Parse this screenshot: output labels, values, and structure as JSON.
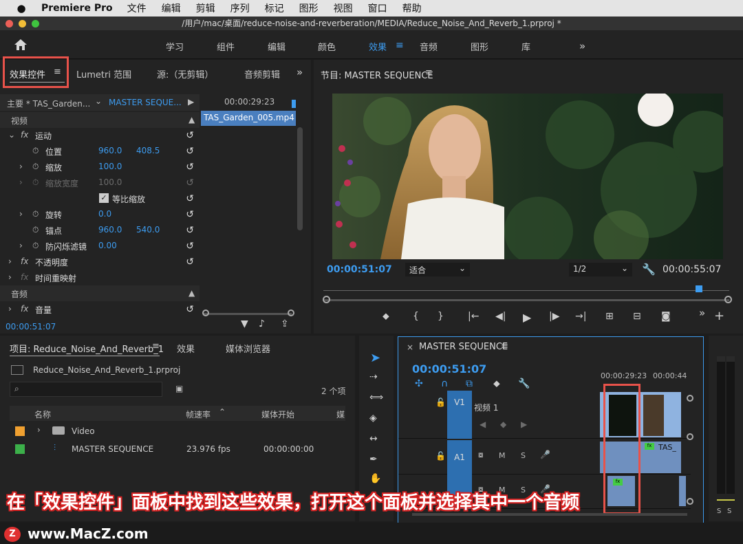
{
  "menubar": {
    "apple": "",
    "app": "Premiere Pro",
    "items": [
      "文件",
      "编辑",
      "剪辑",
      "序列",
      "标记",
      "图形",
      "视图",
      "窗口",
      "帮助"
    ]
  },
  "titlebar": {
    "path": "/用户/mac/桌面/reduce-noise-and-reverberation/MEDIA/Reduce_Noise_And_Reverb_1.prproj *"
  },
  "workspaces": {
    "items": [
      "学习",
      "组件",
      "编辑",
      "颜色",
      "效果",
      "音频",
      "图形",
      "库"
    ],
    "active": "效果",
    "more": "»"
  },
  "effect_controls": {
    "tabs": {
      "effect": "效果控件",
      "lumetri": "Lumetri 范围",
      "source": "源:（无剪辑）",
      "audio_clip": "音频剪辑",
      "more": "»"
    },
    "master_clip": "主要 * TAS_Garden...",
    "sequence_clip": "MASTER SEQUE...",
    "timecode_top": "00:00:29:23",
    "clip_name": "TAS_Garden_005.mp4",
    "video_header": "视频",
    "motion": "运动",
    "position": {
      "label": "位置",
      "x": "960.0",
      "y": "408.5"
    },
    "scale": {
      "label": "缩放",
      "value": "100.0"
    },
    "scale_width": {
      "label": "缩放宽度",
      "value": "100.0"
    },
    "uniform": {
      "label": "等比缩放"
    },
    "rotation": {
      "label": "旋转",
      "value": "0.0"
    },
    "anchor": {
      "label": "锚点",
      "x": "960.0",
      "y": "540.0"
    },
    "flicker": {
      "label": "防闪烁滤镜",
      "value": "0.00"
    },
    "opacity": "不透明度",
    "time_remap": "时间重映射",
    "audio_header": "音频",
    "volume": "音量",
    "timecode_bottom": "00:00:51:07"
  },
  "program": {
    "title": "节目: MASTER SEQUENCE",
    "timecode": "00:00:51:07",
    "fit": "适合",
    "resolution": "1/2",
    "duration": "00:00:55:07"
  },
  "project": {
    "tab": "项目: Reduce_Noise_And_Reverb_1",
    "effects_tab": "效果",
    "media_tab": "媒体浏览器",
    "file": "Reduce_Noise_And_Reverb_1.prproj",
    "count": "2 个项",
    "columns": {
      "name": "名称",
      "fps": "帧速率",
      "start": "媒体开始",
      "more": "媒"
    },
    "rows": [
      {
        "name": "Video",
        "fps": "",
        "start": "",
        "color": "#f0a030"
      },
      {
        "name": "MASTER SEQUENCE",
        "fps": "23.976 fps",
        "start": "00:00:00:00",
        "color": "#3cb04a"
      }
    ]
  },
  "timeline": {
    "title": "MASTER SEQUENCE",
    "timecode": "00:00:51:07",
    "ruler_a": "00:00:29:23",
    "ruler_b": "00:00:44",
    "v1": "V1",
    "video_name": "视频 1",
    "a1": "A1",
    "m": "M",
    "s": "S",
    "clip_label": "TAS_",
    "meter_s": "S"
  },
  "caption": "在「效果控件」面板中找到这些效果，打开这个面板并选择其中一个音频",
  "watermark": "www.MacZ.com",
  "colors": {
    "accent": "#3d9cf0",
    "highlight": "#e8524a",
    "clip": "#8fb3e0",
    "track": "#2d6fb0"
  }
}
